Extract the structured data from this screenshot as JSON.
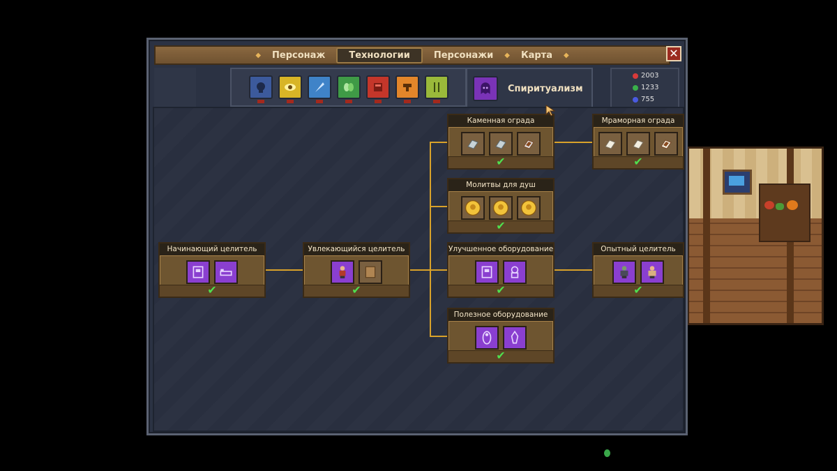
{
  "tabs": [
    {
      "label": "Персонаж",
      "active": false
    },
    {
      "label": "Технологии",
      "active": true
    },
    {
      "label": "Персонажи",
      "active": false
    },
    {
      "label": "Карта",
      "active": false
    }
  ],
  "close_label": "✕",
  "categories": [
    {
      "icon": "skull-icon",
      "color": "#3c5a9c"
    },
    {
      "icon": "eye-icon",
      "color": "#d8b526"
    },
    {
      "icon": "feather-icon",
      "color": "#3f83c8"
    },
    {
      "icon": "leaf-icon",
      "color": "#3f9a46"
    },
    {
      "icon": "crate-icon",
      "color": "#c4362a"
    },
    {
      "icon": "anvil-icon",
      "color": "#e3862a"
    },
    {
      "icon": "cutlery-icon",
      "color": "#9ab93a"
    }
  ],
  "active_category": {
    "label": "Спиритуализм",
    "icon": "ghost-icon",
    "color": "#7a33b7"
  },
  "resources": [
    {
      "value": "2003",
      "color": "#d83a3a",
      "icon": "red-orb-icon"
    },
    {
      "value": "1233",
      "color": "#3ab04a",
      "icon": "green-orb-icon"
    },
    {
      "value": "755",
      "color": "#4a5ae0",
      "icon": "blue-orb-icon"
    }
  ],
  "nodes": {
    "novice_healer": {
      "title": "Начинающий целитель",
      "items": [
        "altar-icon",
        "bed-icon"
      ],
      "learned": true
    },
    "keen_healer": {
      "title": "Увлекающийся целитель",
      "items": [
        "worker-icon",
        "scroll-icon"
      ],
      "learned": true
    },
    "stone_fence": {
      "title": "Каменная ограда",
      "items": [
        "stone-slab-icon",
        "stone-slab-icon",
        "grave-fence-icon"
      ],
      "learned": true
    },
    "soul_prayers": {
      "title": "Молитвы для душ",
      "items": [
        "gold-coin-icon",
        "gold-coin-icon",
        "gold-coin-icon"
      ],
      "learned": true
    },
    "improved_equipment": {
      "title": "Улучшенное оборудование",
      "items": [
        "altar-icon",
        "robot-icon"
      ],
      "learned": true
    },
    "useful_equipment": {
      "title": "Полезное оборудование",
      "items": [
        "body-icon",
        "lamp-icon"
      ],
      "learned": true
    },
    "marble_fence": {
      "title": "Мраморная ограда",
      "items": [
        "marble-slab-icon",
        "marble-slab-icon",
        "grave-fence-icon"
      ],
      "learned": true
    },
    "experienced_healer": {
      "title": "Опытный целитель",
      "items": [
        "zombie-icon",
        "worker-icon"
      ],
      "learned": true
    }
  },
  "check_glyph": "✔"
}
